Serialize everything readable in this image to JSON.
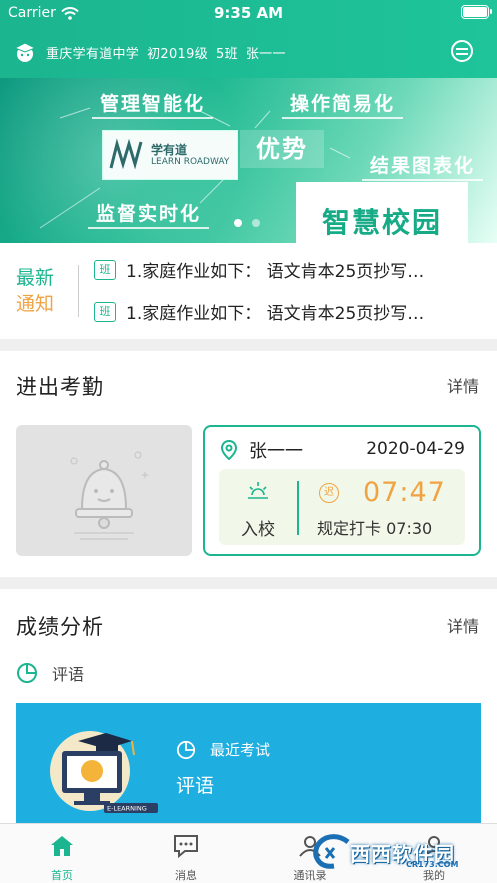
{
  "status": {
    "carrier": "Carrier",
    "time": "9:35 AM"
  },
  "header": {
    "school": "重庆学有道中学",
    "grade": "初2019级",
    "class": "5班",
    "student": "张一一"
  },
  "banner": {
    "tags": [
      "管理智能化",
      "操作简易化",
      "结果图表化",
      "监督实时化"
    ],
    "advantage": "优势",
    "logo_cn": "学有道",
    "logo_en": "LEARN ROADWAY",
    "smart_campus": "智慧校园"
  },
  "notice": {
    "label_line1": "最新",
    "label_line2": "通知",
    "badge": "班",
    "items": [
      "1.家庭作业如下：  语文肯本25页抄写…",
      "1.家庭作业如下：  语文肯本25页抄写…"
    ]
  },
  "attendance": {
    "title": "进出考勤",
    "more": "详情",
    "name": "张一一",
    "date": "2020-04-29",
    "in_label": "入校",
    "late_badge": "迟",
    "time": "07:47",
    "rule": "规定打卡 07:30"
  },
  "grades": {
    "title": "成绩分析",
    "more": "详情",
    "comment": "评语",
    "recent_exam": "最近考试",
    "exam_comment": "评语",
    "art_label": "E-LEARNING"
  },
  "tabs": [
    "首页",
    "消息",
    "通讯录",
    "我的"
  ],
  "watermark": {
    "text": "西西软件园",
    "sub": "CR173.COM"
  }
}
